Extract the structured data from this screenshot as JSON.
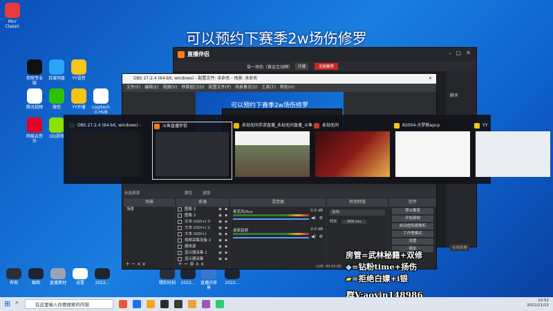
{
  "overlay_title": "可以预约下赛季2w场伤修罗",
  "desktop_icons": [
    {
      "label": "Micr Classic",
      "color": "#e83b3b"
    },
    {
      "label": "剪映专业版",
      "color": "#111111"
    },
    {
      "label": "百度网盘",
      "color": "#2aa4f4"
    },
    {
      "label": "YY语音",
      "color": "#f5c518"
    },
    {
      "label": "腾讯视频",
      "color": "#ffffff"
    },
    {
      "label": "微信",
      "color": "#2dc100"
    },
    {
      "label": "YY开播",
      "color": "#f5c518"
    },
    {
      "label": "Logitech G HUB",
      "color": "#ffffff"
    },
    {
      "label": "网易云音乐",
      "color": "#e60026"
    },
    {
      "label": "QQ游戏",
      "color": "#8ee000"
    }
  ],
  "bottom_icons": [
    {
      "label": "有图",
      "color": "#2a2f3a"
    },
    {
      "label": "截图",
      "color": "#1e2430"
    },
    {
      "label": "直播素材",
      "color": "#9aa4b4"
    },
    {
      "label": "设置",
      "color": "#ffffff"
    },
    {
      "label": "2022...",
      "color": "#1e2430"
    },
    {
      "label": "精彩时刻",
      "color": "#2a2f3a"
    },
    {
      "label": "2022...",
      "color": "#1e2430"
    },
    {
      "label": "直播间背景",
      "color": "#3a77d0"
    },
    {
      "label": "2022...",
      "color": "#1e2430"
    }
  ],
  "livehelper": {
    "title": "直播伴侣",
    "tab1": "倍一场伤（黄金互动牌）",
    "btn1": "开播",
    "btn2": "无损推荐",
    "right1": "聊天",
    "right_btn": "在线观看"
  },
  "obs": {
    "title": "OBS 27.2.4 (64-bit, windows) - 配置文件: 未命名 - 场景: 未命名",
    "menu": [
      "文件(F)",
      "编辑(E)",
      "视图(V)",
      "停靠窗口(D)",
      "配置文件(P)",
      "场景集合(S)",
      "工具(T)",
      "帮助(H)"
    ],
    "preview_title": "可以预约下赛季2w场伤修罗",
    "status_bar": "未选择源",
    "prop_btn": "属性",
    "filter_btn": "滤镜",
    "panels": {
      "scenes": "场景",
      "sources": "来源",
      "mixer": "混音器",
      "transitions": "转场特效",
      "controls": "控件"
    },
    "scene_items": [
      "场景"
    ],
    "source_items": [
      "图像 3",
      "图像 2",
      "文本 (GDI+) 3",
      "文本 (GDI+) 2",
      "文本 (GDI+)",
      "视频采集设备 2",
      "媒体源",
      "显示器采集 2",
      "显示器采集"
    ],
    "mixer": [
      {
        "name": "麦克风/Aux",
        "level": "0.0 dB"
      },
      {
        "name": "桌面音频",
        "level": "0.0 dB"
      }
    ],
    "transition": "淡出",
    "duration_label": "时长",
    "duration": "300 ms",
    "controls": [
      "停止推流",
      "开始录制",
      "启动虚拟摄像机",
      "工作室模式",
      "设置",
      "退出"
    ],
    "live_status": "LIVE: 00:00:00"
  },
  "switcher": [
    {
      "label": "OBS 27.2.4 (64-bit, windows) - ...",
      "icon": "#2b2b2b"
    },
    {
      "label": "斗鱼直播伴侣",
      "icon": "#ff7a1a"
    },
    {
      "label": "永劫无间手游直播_永劫无间直播_斗鱼直...",
      "icon": "#f4b400"
    },
    {
      "label": "永劫无间",
      "icon": "#c0392b"
    },
    {
      "label": "B2004-大罗斯apcp",
      "icon": "#f5c518"
    },
    {
      "label": "YY",
      "icon": "#f5c518"
    }
  ],
  "promo": {
    "line1": "房管=武林秘籍+双修",
    "line2": "=钻粉time+扬伤",
    "line3": "=拒绝白嫖+i银",
    "line4": "群V:aoyin148986"
  },
  "taskbar": {
    "search_placeholder": "在这里输入你要搜索的内容",
    "time": "10:52",
    "date": "2022/11/15",
    "apps": [
      "#e8553b",
      "#1a73e8",
      "#f5a623",
      "#2c2c2c",
      "#3a3a3a",
      "#e8a33b",
      "#9b59b6",
      "#2ecc71"
    ]
  },
  "colors": {
    "accent_red": "#e53935",
    "obs_bg": "#2b2d31",
    "live_bg": "#1c1e22"
  }
}
